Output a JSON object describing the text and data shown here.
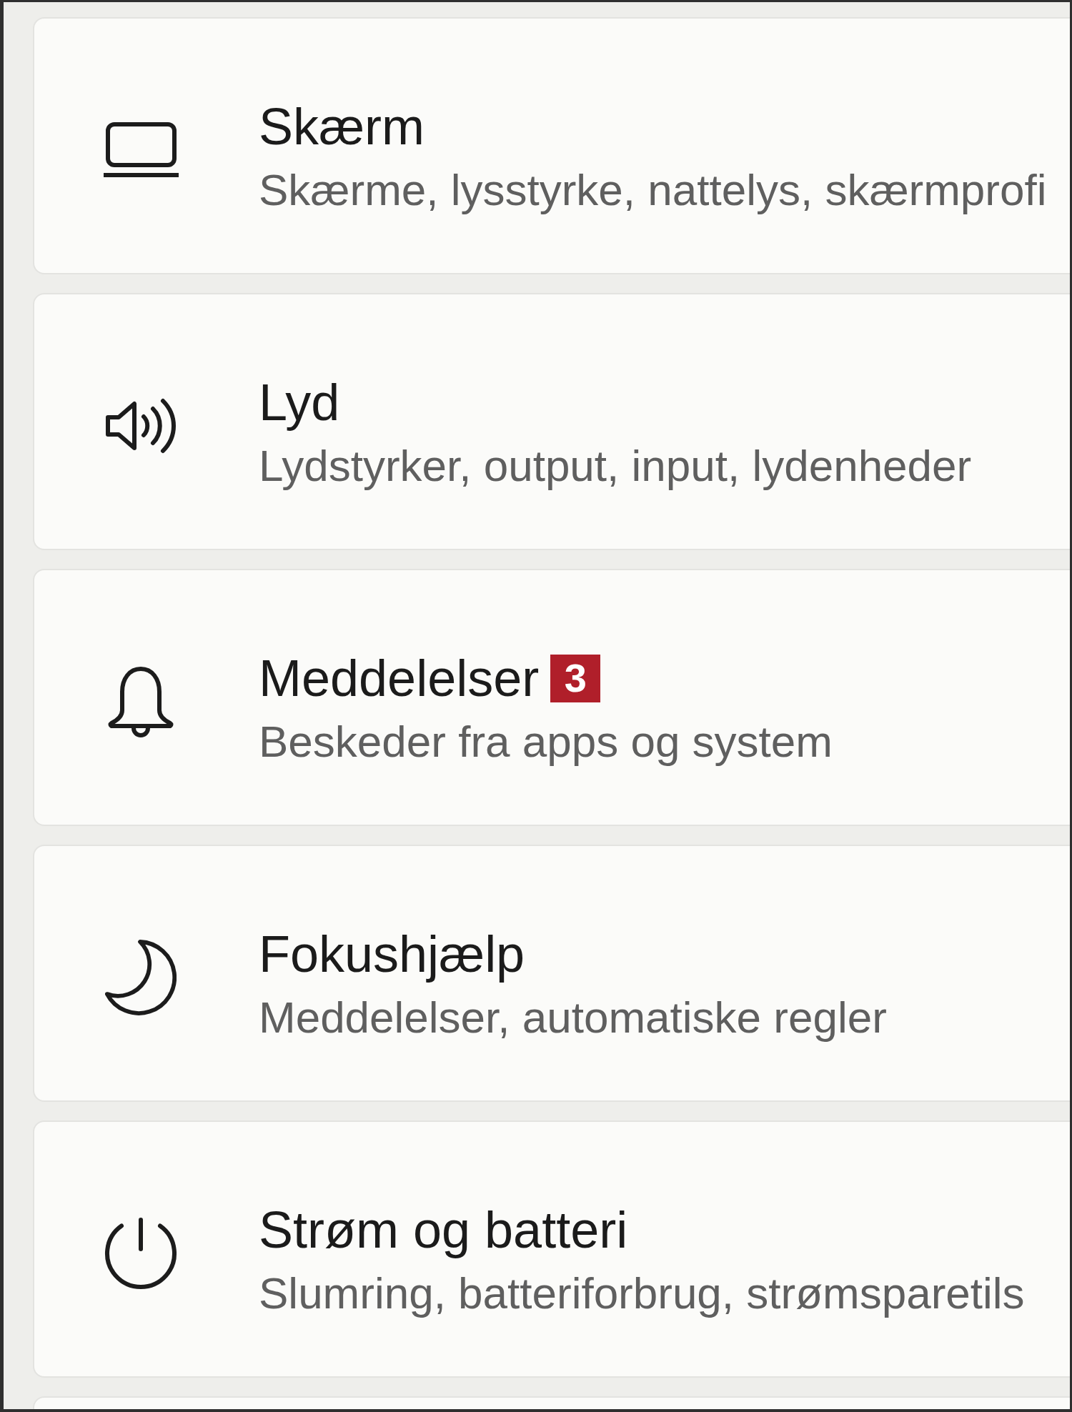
{
  "settings_items": [
    {
      "title": "Skærm",
      "description": "Skærme, lysstyrke, nattelys, skærmprofi"
    },
    {
      "title": "Lyd",
      "description": "Lydstyrker, output, input, lydenheder"
    },
    {
      "title": "Meddelelser",
      "badge": "3",
      "description": "Beskeder fra apps og system"
    },
    {
      "title": "Fokushjælp",
      "description": "Meddelelser, automatiske regler"
    },
    {
      "title": "Strøm og batteri",
      "description": "Slumring, batteriforbrug, strømsparetils"
    }
  ]
}
